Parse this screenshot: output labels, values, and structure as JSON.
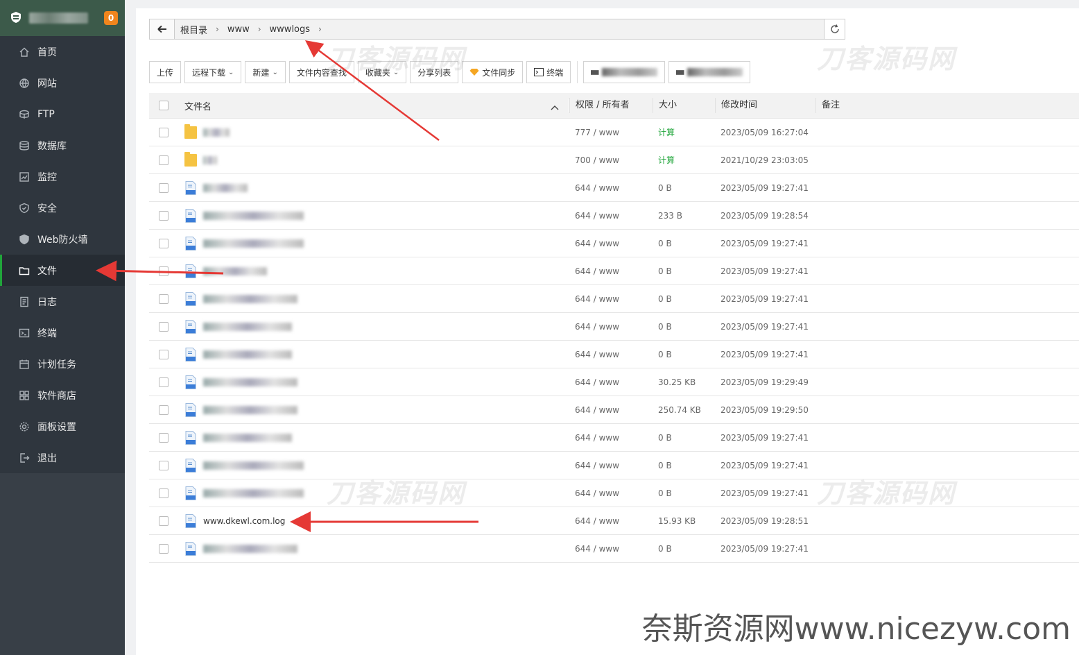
{
  "sidebar": {
    "badge": "0",
    "items": [
      {
        "label": "首页",
        "icon": "home-icon",
        "active": false
      },
      {
        "label": "网站",
        "icon": "globe-icon",
        "active": false
      },
      {
        "label": "FTP",
        "icon": "ftp-icon",
        "active": false
      },
      {
        "label": "数据库",
        "icon": "database-icon",
        "active": false
      },
      {
        "label": "监控",
        "icon": "monitor-icon",
        "active": false
      },
      {
        "label": "安全",
        "icon": "shield-icon",
        "active": false
      },
      {
        "label": "Web防火墙",
        "icon": "firewall-icon",
        "active": false
      },
      {
        "label": "文件",
        "icon": "folder-icon",
        "active": true
      },
      {
        "label": "日志",
        "icon": "log-icon",
        "active": false
      },
      {
        "label": "终端",
        "icon": "terminal-icon",
        "active": false
      },
      {
        "label": "计划任务",
        "icon": "calendar-icon",
        "active": false
      },
      {
        "label": "软件商店",
        "icon": "apps-icon",
        "active": false
      },
      {
        "label": "面板设置",
        "icon": "settings-icon",
        "active": false
      },
      {
        "label": "退出",
        "icon": "logout-icon",
        "active": false
      }
    ]
  },
  "breadcrumb": [
    "根目录",
    "www",
    "wwwlogs"
  ],
  "toolbar": {
    "upload": "上传",
    "remote_download": "远程下载",
    "new": "新建",
    "search_content": "文件内容查找",
    "favorites": "收藏夹",
    "share_list": "分享列表",
    "file_sync": "文件同步",
    "terminal": "终端"
  },
  "table": {
    "headers": {
      "name": "文件名",
      "perm": "权限 / 所有者",
      "size": "大小",
      "time": "修改时间",
      "note": "备注"
    },
    "rows": [
      {
        "type": "folder",
        "name": "",
        "perm": "777 / www",
        "size": "计算",
        "time": "2023/05/09 16:27:04"
      },
      {
        "type": "folder",
        "name": "",
        "perm": "700 / www",
        "size": "计算",
        "time": "2021/10/29 23:03:05"
      },
      {
        "type": "file",
        "name": "",
        "perm": "644 / www",
        "size": "0 B",
        "time": "2023/05/09 19:27:41"
      },
      {
        "type": "file",
        "name": "",
        "perm": "644 / www",
        "size": "233 B",
        "time": "2023/05/09 19:28:54"
      },
      {
        "type": "file",
        "name": "",
        "perm": "644 / www",
        "size": "0 B",
        "time": "2023/05/09 19:27:41"
      },
      {
        "type": "file",
        "name": "",
        "perm": "644 / www",
        "size": "0 B",
        "time": "2023/05/09 19:27:41"
      },
      {
        "type": "file",
        "name": "",
        "perm": "644 / www",
        "size": "0 B",
        "time": "2023/05/09 19:27:41"
      },
      {
        "type": "file",
        "name": "",
        "perm": "644 / www",
        "size": "0 B",
        "time": "2023/05/09 19:27:41"
      },
      {
        "type": "file",
        "name": "",
        "perm": "644 / www",
        "size": "0 B",
        "time": "2023/05/09 19:27:41"
      },
      {
        "type": "file",
        "name": "",
        "perm": "644 / www",
        "size": "30.25 KB",
        "time": "2023/05/09 19:29:49"
      },
      {
        "type": "file",
        "name": "",
        "perm": "644 / www",
        "size": "250.74 KB",
        "time": "2023/05/09 19:29:50"
      },
      {
        "type": "file",
        "name": "",
        "perm": "644 / www",
        "size": "0 B",
        "time": "2023/05/09 19:27:41"
      },
      {
        "type": "file",
        "name": "",
        "perm": "644 / www",
        "size": "0 B",
        "time": "2023/05/09 19:27:41"
      },
      {
        "type": "file",
        "name": "",
        "perm": "644 / www",
        "size": "0 B",
        "time": "2023/05/09 19:27:41"
      },
      {
        "type": "file",
        "name": "www.dkewl.com.log",
        "perm": "644 / www",
        "size": "15.93 KB",
        "time": "2023/05/09 19:28:51"
      },
      {
        "type": "file",
        "name": "",
        "perm": "644 / www",
        "size": "0 B",
        "time": "2023/05/09 19:27:41"
      }
    ]
  },
  "watermarks": [
    "刀客源码网",
    "刀客源码网",
    "刀客源码网",
    "刀客源码网"
  ],
  "footer_mark": "奈斯资源网www.nicezyw.com",
  "colors": {
    "accent": "#20a53a",
    "sidebar": "#383f47",
    "arrow": "#e53935",
    "badge": "#f0851d"
  }
}
